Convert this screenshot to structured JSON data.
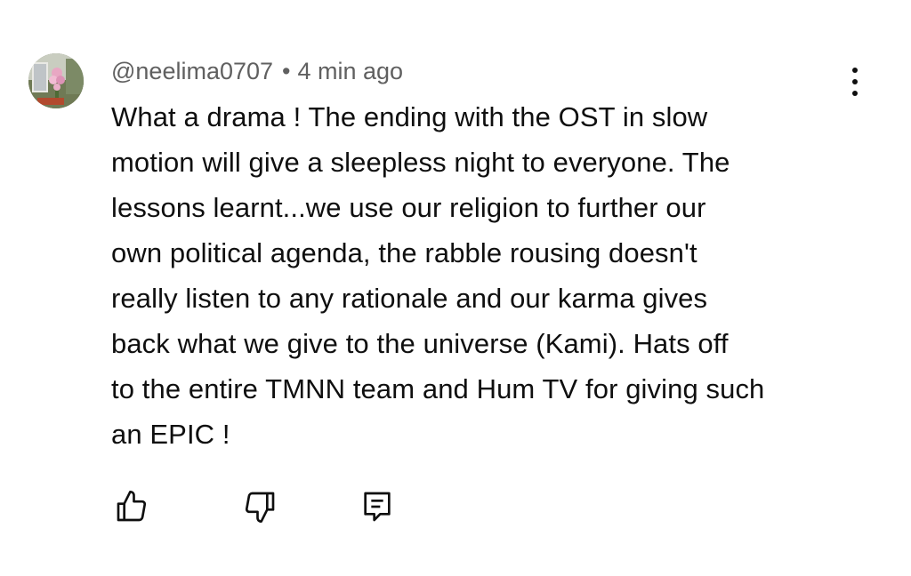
{
  "comment": {
    "author": "@neelima0707",
    "separator": "•",
    "time": "4 min ago",
    "text": "What a drama ! The ending with the OST in slow\nmotion will give a sleepless night to everyone. The\nlessons learnt...we use our religion to further our\nown political agenda, the rabble rousing doesn't\nreally listen to any rationale and our karma gives\nback what we give to the universe (Kami).  Hats off\nto the entire TMNN team and Hum TV for giving such\nan EPIC !"
  },
  "actions": {
    "like_icon": "thumbs-up-icon",
    "dislike_icon": "thumbs-down-icon",
    "reply_icon": "reply-comment-icon",
    "menu_icon": "more-vertical-icon"
  },
  "colors": {
    "text": "#0f0f0f",
    "meta": "#606060",
    "background": "#ffffff"
  }
}
